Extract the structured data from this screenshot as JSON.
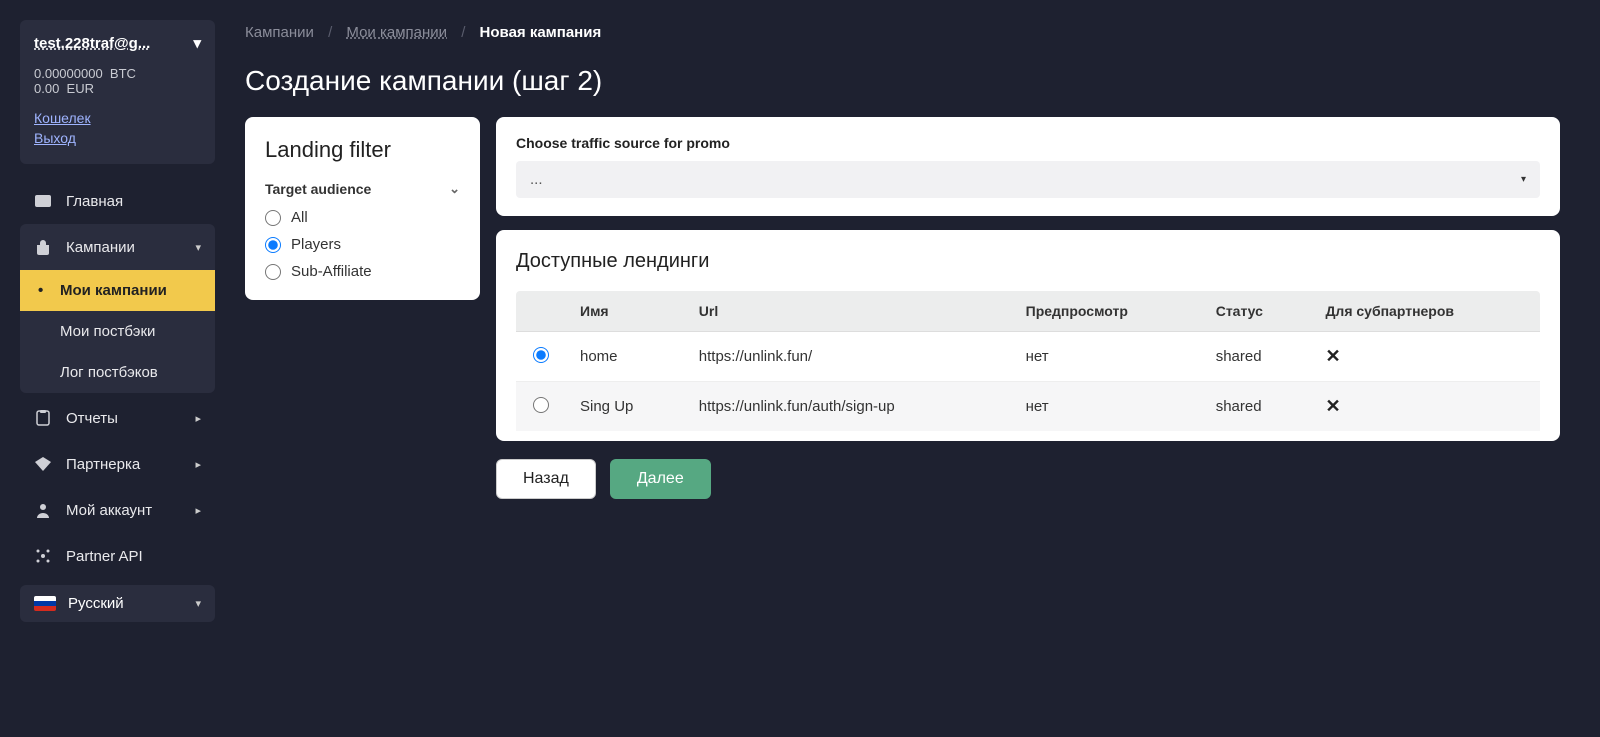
{
  "user": {
    "email": "test.228traf@g...",
    "balances": [
      {
        "amount": "0.00000000",
        "cur": "BTC"
      },
      {
        "amount": "0.00",
        "cur": "EUR"
      }
    ],
    "wallet_link": "Кошелек",
    "logout_link": "Выход"
  },
  "nav": {
    "home": "Главная",
    "campaigns": "Кампании",
    "campaigns_sub": {
      "my_campaigns": "Мои кампании",
      "my_postbacks": "Мои постбэки",
      "postback_log": "Лог постбэков"
    },
    "reports": "Отчеты",
    "partner": "Партнерка",
    "account": "Мой аккаунт",
    "partner_api": "Partner API",
    "language": "Русский"
  },
  "breadcrumb": {
    "b1": "Кампании",
    "b2": "Мои кампании",
    "b3": "Новая кампания"
  },
  "page_title": "Создание кампании (шаг 2)",
  "filter": {
    "title": "Landing filter",
    "section": "Target audience",
    "options": {
      "all": "All",
      "players": "Players",
      "subaff": "Sub-Affiliate"
    }
  },
  "traffic": {
    "label": "Choose traffic source for promo",
    "value": "..."
  },
  "landings": {
    "title": "Доступные лендинги",
    "headers": {
      "name": "Имя",
      "url": "Url",
      "preview": "Предпросмотр",
      "status": "Статус",
      "forsub": "Для субпартнеров"
    },
    "rows": [
      {
        "name": "home",
        "url": "https://unlink.fun/",
        "preview": "нет",
        "status": "shared",
        "forsub_x": true,
        "selected": true
      },
      {
        "name": "Sing Up",
        "url": "https://unlink.fun/auth/sign-up",
        "preview": "нет",
        "status": "shared",
        "forsub_x": true,
        "selected": false
      }
    ]
  },
  "buttons": {
    "back": "Назад",
    "next": "Далее"
  }
}
